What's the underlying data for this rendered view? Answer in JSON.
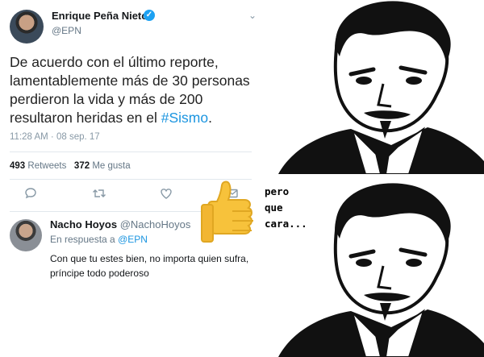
{
  "tweet": {
    "author_name": "Enrique Peña Nieto",
    "author_handle": "@EPN",
    "verified_icon": "verified-badge-icon",
    "text_before_hashtag": "De acuerdo con el último reporte, lamentablemente más de 30 personas perdieron la vida y más de 200 resultaron heridas en el ",
    "hashtag": "#Sismo",
    "text_after_hashtag": ".",
    "timestamp": "11:28 AM · 08 sep. 17",
    "retweets_count": "493",
    "retweets_label": "Retweets",
    "likes_count": "372",
    "likes_label": "Me gusta",
    "actions": [
      "reply-icon",
      "retweet-icon",
      "like-icon",
      "message-icon"
    ]
  },
  "reply": {
    "author_name": "Nacho Hoyos",
    "author_handle": "@NachoHoyos",
    "in_reply_prefix": "En respuesta a",
    "in_reply_mention": "@EPN",
    "text": "Con que tu estes bien, no importa quien sufra, príncipe todo poderoso"
  },
  "meme": {
    "caption": "pero\nque\ncara...",
    "face": "are-you-serious-face",
    "thumbs_up": "thumbs-up-emoji"
  },
  "colors": {
    "link": "#1b95e0",
    "verified": "#1da1f2",
    "muted": "#657786",
    "thumb": "#f7c23b"
  }
}
